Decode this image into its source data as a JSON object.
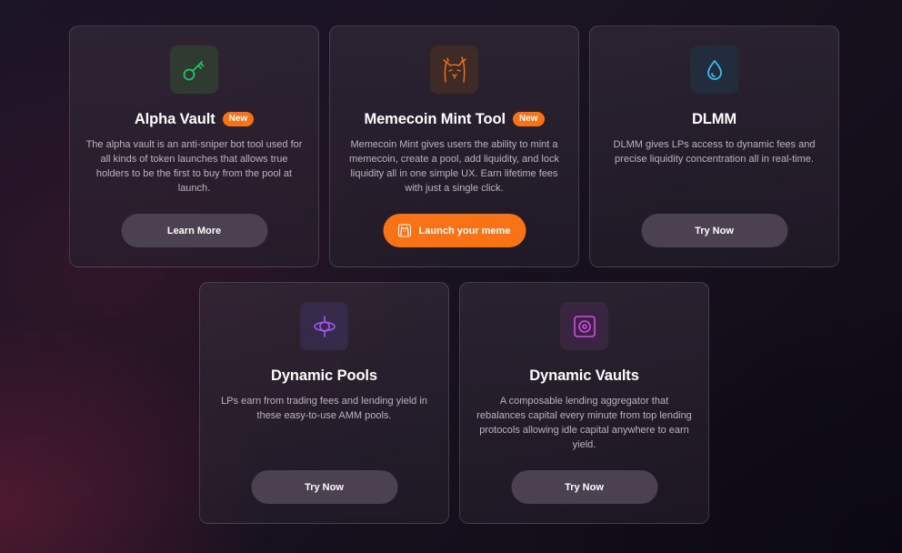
{
  "cards": [
    {
      "title": "Alpha Vault",
      "badge": "New",
      "description": "The alpha vault is an anti-sniper bot tool used for all kinds of token launches that allows true holders to be the first to buy from the pool at launch.",
      "button": "Learn More",
      "icon": "key-icon",
      "accent": "#22c55e"
    },
    {
      "title": "Memecoin Mint Tool",
      "badge": "New",
      "description": "Memecoin Mint gives users the ability to mint a memecoin, create a pool, add liquidity, and lock liquidity all in one simple UX. Earn lifetime fees with just a single click.",
      "button": "Launch your meme",
      "icon": "cat-icon",
      "accent": "#f97316"
    },
    {
      "title": "DLMM",
      "description": "DLMM gives LPs access to dynamic fees and precise liquidity concentration all in real-time.",
      "button": "Try Now",
      "icon": "droplet-icon",
      "accent": "#38bdf8"
    },
    {
      "title": "Dynamic Pools",
      "description": "LPs earn from trading fees and lending yield in these easy-to-use AMM pools.",
      "button": "Try Now",
      "icon": "orbit-icon",
      "accent": "#a855f7"
    },
    {
      "title": "Dynamic Vaults",
      "description": "A composable lending aggregator that rebalances capital every minute from top lending protocols allowing idle capital anywhere to earn yield.",
      "button": "Try Now",
      "icon": "vault-icon",
      "accent": "#d946ef"
    }
  ]
}
